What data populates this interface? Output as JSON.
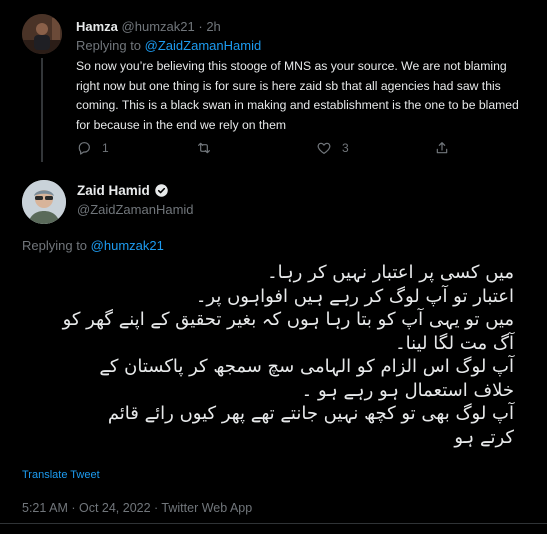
{
  "reply": {
    "name": "Hamza",
    "handle": "@humzak21",
    "separator": "·",
    "time": "2h",
    "replying_prefix": "Replying to",
    "replying_to": "@ZaidZamanHamid",
    "text": "So now you’re believing this stooge of MNS as your source. We are not blaming right now but one thing is for sure is here zaid sb that all agencies had saw this coming. This is a black swan in making and establishment is the one to be blamed for because in the end we rely on them",
    "reply_count": "1",
    "like_count": "3"
  },
  "main": {
    "name": "Zaid Hamid",
    "handle": "@ZaidZamanHamid",
    "replying_prefix": "Replying to",
    "replying_to": "@humzak21",
    "lines": [
      "میں کسی پر اعتبار نہیں کر رہا۔",
      "اعتبار تو آپ لوگ کر رہے ہیں افواہوں پر۔",
      "میں تو یہی آپ کو بتا رہا ہوں کہ بغیر تحقیق کے اپنے گھر کو",
      "آگ مت لگا لینا۔",
      "آپ لوگ اس الزام کو الہامی سچ سمجھ کر پاکستان کے",
      "خلاف استعمال ہو رہے ہو ۔",
      "آپ لوگ بھی تو کچھ نہیں جانتے تھے پھر کیوں رائے قائم",
      "کرتے ہو"
    ],
    "translate_label": "Translate Tweet",
    "timestamp": "5:21 AM · Oct 24, 2022 · Twitter Web App"
  },
  "icons": {
    "reply": "reply-icon",
    "retweet": "retweet-icon",
    "like": "heart-icon",
    "share": "share-icon",
    "verified": "verified-badge-icon"
  },
  "colors": {
    "background": "#000000",
    "text": "#e7e9ea",
    "secondary": "#71767b",
    "accent": "#1d9bf0"
  }
}
